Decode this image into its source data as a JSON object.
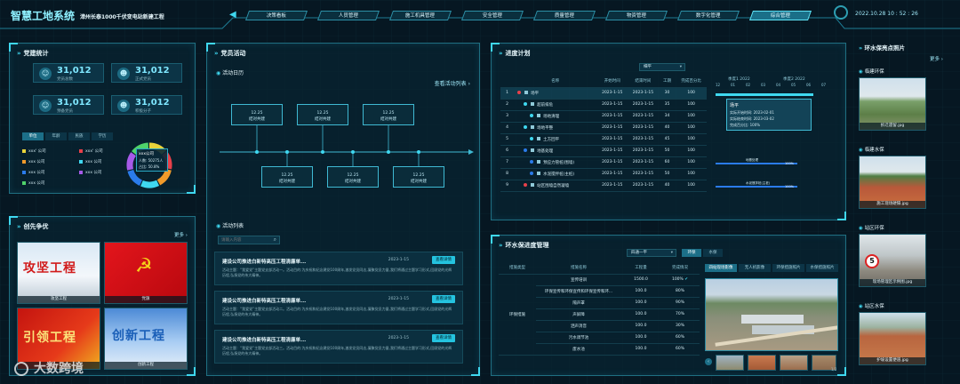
{
  "header": {
    "logo_title": "智慧工地系统",
    "project_name": "漳州长泰1000千伏变电站新建工程",
    "datetime": "2022.10.28  10 : 52 : 26",
    "nav": [
      "决策看板",
      "人员管理",
      "施工机具管理",
      "安全管理",
      "质量管理",
      "物资管理",
      "数字化管理",
      "综合管理"
    ],
    "active_nav": 7
  },
  "party": {
    "title": "党建统计",
    "stats": [
      {
        "value": "31,012",
        "label": "党员总数"
      },
      {
        "value": "31,012",
        "label": "正式党员"
      },
      {
        "value": "31,012",
        "label": "预备党员"
      },
      {
        "value": "31,012",
        "label": "积极分子"
      }
    ],
    "tabs": [
      "单位",
      "年龄",
      "民族",
      "学历"
    ],
    "legend": [
      {
        "label": "xxx' 公司",
        "color": "#e9d33a"
      },
      {
        "label": "xxx' 公司",
        "color": "#e8404a"
      },
      {
        "label": "xxx 公司",
        "color": "#f09a2a"
      },
      {
        "label": "xxx 公司",
        "color": "#3fd8f0"
      },
      {
        "label": "xxx 公司",
        "color": "#2a7bea"
      },
      {
        "label": "xxx 公司",
        "color": "#a65ae8"
      },
      {
        "label": "xxx 公司",
        "color": "#4fd26a"
      }
    ],
    "donut": {
      "name": "xxx公司",
      "count_label": "人数: 50275人",
      "ratio_label": "占比: 50.8%"
    }
  },
  "pioneer": {
    "title": "创先争优",
    "more": "更多",
    "items": [
      {
        "banner": "攻坚工程",
        "caption": "攻坚工程"
      },
      {
        "banner": "",
        "caption": "党旗"
      },
      {
        "banner": "引领工程",
        "caption": ""
      },
      {
        "banner": "创新工程",
        "caption": "创新工程"
      }
    ]
  },
  "party_activity": {
    "title": "党员活动",
    "calendar_title": "活动日历",
    "view_list": "查看活动列表",
    "timeline_top": [
      {
        "date": "12.25",
        "label": "结对共建"
      },
      {
        "date": "12.25",
        "label": "结对共建"
      },
      {
        "date": "12.25",
        "label": "结对共建"
      }
    ],
    "timeline_bottom": [
      {
        "date": "12.25",
        "label": "结对共建"
      },
      {
        "date": "12.25",
        "label": "结对共建"
      },
      {
        "date": "12.25",
        "label": "结对共建"
      }
    ],
    "list_title": "活动列表",
    "search_placeholder": "请输入内容",
    "news": [
      {
        "title": "建设公司推进白新特高压工程清廉单...",
        "date": "2023-1-15",
        "button": "查看详情",
        "text": "活动主题：“我爱党”主题党支部活动一。活动目的:为庆祝和纪念建党100周年,激发党员同志,凝聚党员力量,我们将通过主题学习形式,回顾党的光辉历程,弘扬党的伟大精神。"
      },
      {
        "title": "建设公司推进白新特高压工程清廉单...",
        "date": "2023-1-15",
        "button": "查看详情",
        "text": "活动主题：“我爱党”主题党支部活动二。活动目的:为庆祝和纪念建党100周年,激发党员同志,凝聚党员力量,我们将通过主题学习形式,回顾党的光辉历程,弘扬党的伟大精神。"
      },
      {
        "title": "建设公司推进白新特高压工程清廉单...",
        "date": "2023-1-15",
        "button": "查看详情",
        "text": "活动主题：“我爱党”主题党支部活动三。活动目的:为庆祝和纪念建党100周年,激发党员同志,凝聚党员力量,我们将通过主题学习形式,回顾党的光辉历程,弘扬党的伟大精神。"
      }
    ]
  },
  "progress": {
    "title": "进度计划",
    "select_value": "细平",
    "columns": [
      "名称",
      "开始时间",
      "结束时间",
      "工期",
      "完成百分比"
    ],
    "months": [
      "季度1 2022",
      "季度2 2022"
    ],
    "month_cols": [
      "12",
      "01",
      "02",
      "03",
      "04",
      "05",
      "06",
      "07"
    ],
    "rows": [
      {
        "name": "场平",
        "start": "2023-1-15",
        "end": "2023-1-15",
        "days": "30",
        "pct": "100",
        "dot": "#e8404a",
        "indent": 0,
        "num": "1"
      },
      {
        "name": "超前排危",
        "start": "2023-1-15",
        "end": "2023-1-15",
        "days": "35",
        "pct": "100",
        "dot": "#3fd8f0",
        "indent": 1,
        "num": "2"
      },
      {
        "name": "场地清理",
        "start": "2023-1-15",
        "end": "2023-1-15",
        "days": "34",
        "pct": "100",
        "dot": "#3fd8f0",
        "indent": 2,
        "num": "3"
      },
      {
        "name": "场地平整",
        "start": "2023-1-15",
        "end": "2023-1-15",
        "days": "40",
        "pct": "100",
        "dot": "#3fd8f0",
        "indent": 1,
        "num": "4"
      },
      {
        "name": "土方回平",
        "start": "2023-1-15",
        "end": "2023-1-15",
        "days": "45",
        "pct": "100",
        "dot": "#3fd8f0",
        "indent": 2,
        "num": "5"
      },
      {
        "name": "地基处理",
        "start": "2023-1-15",
        "end": "2023-1-15",
        "days": "50",
        "pct": "100",
        "dot": "#2a7bea",
        "indent": 1,
        "num": "6"
      },
      {
        "name": "预应力管桩(围墙)",
        "start": "2023-1-15",
        "end": "2023-1-15",
        "days": "60",
        "pct": "100",
        "dot": "#2a7bea",
        "indent": 2,
        "num": "7"
      },
      {
        "name": "水泥搅拌桩(主桩)",
        "start": "2023-1-15",
        "end": "2023-1-15",
        "days": "50",
        "pct": "100",
        "dot": "#2a7bea",
        "indent": 2,
        "num": "8"
      },
      {
        "name": "站区围墙自然凝墙",
        "start": "2023-1-15",
        "end": "2023-1-15",
        "days": "40",
        "pct": "100",
        "dot": "#e8404a",
        "indent": 1,
        "num": "9"
      }
    ],
    "tooltip": {
      "title": "场平",
      "actual_start": "实际开始时间: 2023-02-01",
      "actual_end": "实际结束时间: 2023-03-02",
      "done": "完成百分比: 100%"
    },
    "bar_labels": [
      "地基处理",
      "水泥搅拌桩(主桩)"
    ],
    "bar_pct": [
      "100%",
      "100%"
    ]
  },
  "env": {
    "title": "环水保进度管理",
    "select_value": "四通一平",
    "tab1": "环保",
    "tab2": "水保",
    "columns": [
      "措施类型",
      "措施名称",
      "工程量",
      "完成情况"
    ],
    "category": "环保措施",
    "rows": [
      {
        "name": "宣传培训",
        "qty": "1500.0",
        "pct": "100%"
      },
      {
        "name": "环保宣传和环保宣传和环保宣传和环...",
        "qty": "100.0",
        "pct": "80%"
      },
      {
        "name": "隔声罩",
        "qty": "100.0",
        "pct": "90%"
      },
      {
        "name": "声屏障",
        "qty": "100.0",
        "pct": "70%"
      },
      {
        "name": "洒声消音",
        "qty": "100.0",
        "pct": "30%"
      },
      {
        "name": "污水调节池",
        "qty": "100.0",
        "pct": "60%"
      },
      {
        "name": "废水池",
        "qty": "100.0",
        "pct": "60%"
      }
    ],
    "photo_tabs": [
      "四站现场影像",
      "无人机影像",
      "环保措施照片",
      "水保措施照片"
    ],
    "page": "1/2"
  },
  "right": {
    "title": "环水保亮点照片",
    "more": "更多",
    "items": [
      {
        "title": "临建环保",
        "caption": "拆迁遗留.jpg"
      },
      {
        "title": "临建水保",
        "caption": "施工现场硬隔.jpg"
      },
      {
        "title": "站区环保",
        "caption": "现场管理区示例图.jpg"
      },
      {
        "title": "站区水保",
        "caption": "护坡设置便道.jpg"
      }
    ]
  },
  "watermark": "大数跨境"
}
